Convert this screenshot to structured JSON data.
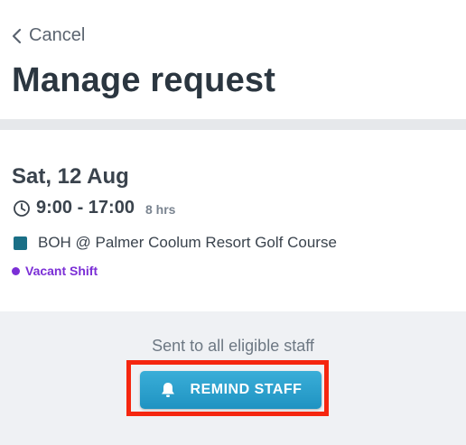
{
  "header": {
    "cancel_label": "Cancel",
    "title": "Manage request"
  },
  "shift": {
    "date": "Sat, 12 Aug",
    "time": "9:00 - 17:00",
    "duration": "8 hrs",
    "location": "BOH @ Palmer Coolum Resort Golf Course",
    "location_color": "#1a6f86",
    "status": "Vacant Shift",
    "status_color": "#7b2fd6"
  },
  "footer": {
    "sent_text": "Sent to all eligible staff",
    "remind_button_label": "REMIND STAFF",
    "highlight_color": "#f5260f"
  },
  "icons": {
    "back": "chevron-left-icon",
    "clock": "clock-icon",
    "bell": "bell-icon"
  }
}
